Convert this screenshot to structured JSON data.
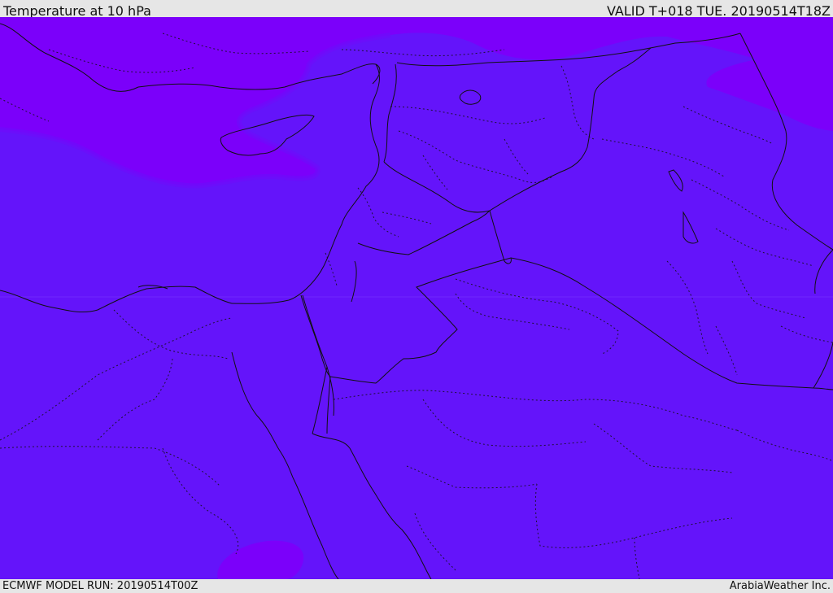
{
  "header": {
    "title": "Temperature at 10 hPa",
    "valid": "VALID T+018 TUE. 20190514T18Z"
  },
  "footer": {
    "model_run": "ECMWF MODEL RUN: 20190514T00Z",
    "credit": "ArabiaWeather Inc."
  },
  "colors": {
    "field_main": "#6414fa",
    "field_warm": "#7b00fa",
    "field_transition": "#6e0cfa",
    "coastline": "#111111",
    "borders": "#111111",
    "background": "#e6e6e6"
  }
}
